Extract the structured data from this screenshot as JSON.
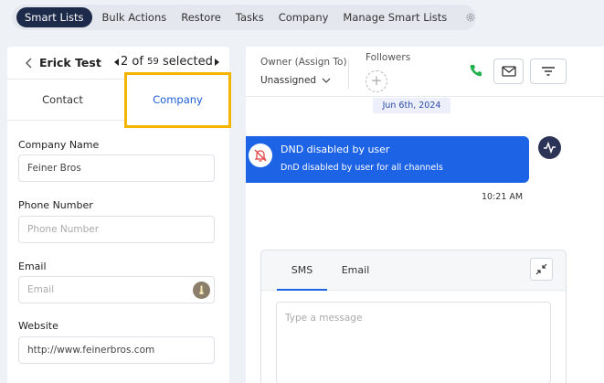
{
  "topnav": {
    "items": [
      {
        "label": "Smart Lists",
        "active": true
      },
      {
        "label": "Bulk Actions",
        "active": false
      },
      {
        "label": "Restore",
        "active": false
      },
      {
        "label": "Tasks",
        "active": false
      },
      {
        "label": "Company",
        "active": false
      },
      {
        "label": "Manage Smart Lists",
        "active": false
      }
    ],
    "settings_icon": "gear-icon"
  },
  "contact_panel": {
    "name": "Erick Test",
    "pager": {
      "current": "2",
      "of_label": "of",
      "total": "59",
      "suffix": "selected"
    },
    "tabs": {
      "contact": "Contact",
      "company": "Company"
    },
    "fields": {
      "company_name": {
        "label": "Company Name",
        "value": "Feiner Bros"
      },
      "phone": {
        "label": "Phone Number",
        "placeholder": "Phone Number"
      },
      "email": {
        "label": "Email",
        "placeholder": "Email"
      },
      "website": {
        "label": "Website",
        "value": "http://www.feinerbros.com"
      }
    }
  },
  "conversation": {
    "owner_label": "Owner (Assign To)",
    "owner_value": "Unassigned",
    "followers_label": "Followers",
    "add_follower": "+",
    "date": "Jun 6th, 2024",
    "message": {
      "title": "DND disabled by user",
      "subtitle": "DnD disabled by user for all channels",
      "time": "10:21 AM"
    },
    "composer": {
      "tabs": {
        "sms": "SMS",
        "email": "Email"
      },
      "placeholder": "Type a message"
    }
  },
  "colors": {
    "nav_active": "#1e2a4a",
    "highlight": "#f5b400",
    "primary_blue": "#1d63e6",
    "phone_green": "#22b14c"
  }
}
